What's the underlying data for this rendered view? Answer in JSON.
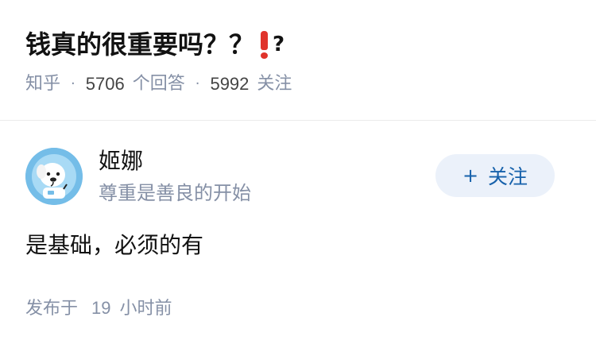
{
  "question": {
    "title": "钱真的很重要吗？？",
    "title_tail": "?",
    "source": "知乎",
    "separator": "·",
    "answer_count": "5706",
    "answer_label": "个回答",
    "follower_count": "5992",
    "follower_label": "关注"
  },
  "author": {
    "name": "姬娜",
    "bio": "尊重是善良的开始",
    "follow_plus": "+",
    "follow_label": "关注"
  },
  "answer": {
    "content": "是基础，必须的有",
    "published_prefix": "发布于",
    "published_number": "19",
    "published_unit": "小时前"
  },
  "colors": {
    "accent": "#1661ab",
    "follow_bg": "#ebf1fa",
    "meta_gray": "#8590a6",
    "exclaim_red": "#e0332b"
  },
  "icons": {
    "title_emoji": "red-exclamation-icon",
    "avatar": "dog-astronaut-avatar"
  }
}
